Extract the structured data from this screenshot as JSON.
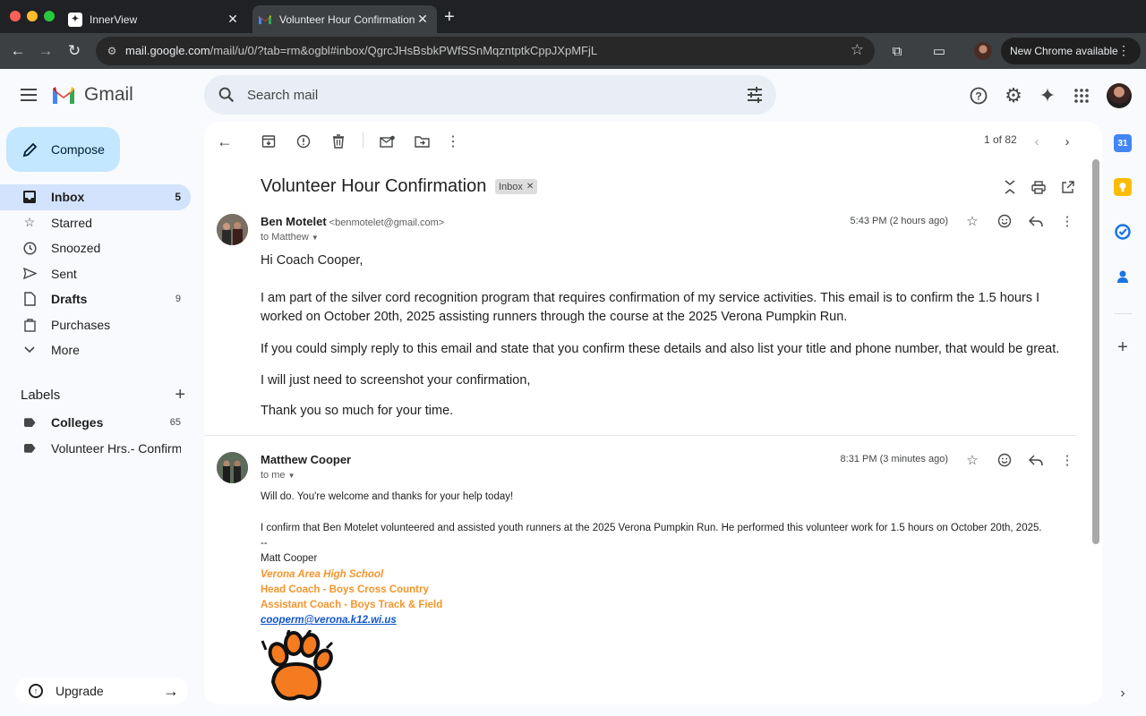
{
  "browser": {
    "tabs": [
      {
        "title": "InnerView",
        "active": false
      },
      {
        "title": "Volunteer Hour Confirmation",
        "active": true
      }
    ],
    "url_host": "mail.google.com",
    "url_path": "/mail/u/0/?tab=rm&ogbl#inbox/QgrcJHsBsbkPWfSSnMqzntptkCppJXpMFjL",
    "update_label": "New Chrome available"
  },
  "gmail": {
    "logo_text": "Gmail",
    "search_placeholder": "Search mail",
    "compose_label": "Compose",
    "nav": [
      {
        "label": "Inbox",
        "count": "5",
        "icon": "inbox-icon"
      },
      {
        "label": "Starred",
        "count": "",
        "icon": "star-icon"
      },
      {
        "label": "Snoozed",
        "count": "",
        "icon": "clock-icon"
      },
      {
        "label": "Sent",
        "count": "",
        "icon": "send-icon"
      },
      {
        "label": "Drafts",
        "count": "9",
        "icon": "draft-icon"
      },
      {
        "label": "Purchases",
        "count": "",
        "icon": "shopping-bag-icon"
      },
      {
        "label": "More",
        "count": "",
        "icon": "chevron-down-icon"
      }
    ],
    "labels_heading": "Labels",
    "labels": [
      {
        "label": "Colleges",
        "count": "65"
      },
      {
        "label": "Volunteer Hrs.- Confirm...",
        "count": ""
      }
    ],
    "upgrade_label": "Upgrade",
    "pager": "1 of 82"
  },
  "thread": {
    "subject": "Volunteer Hour Confirmation",
    "chip": "Inbox",
    "messages": [
      {
        "sender": "Ben Motelet",
        "email": "<benmotelet@gmail.com>",
        "to": "to Matthew",
        "time": "5:43 PM (2 hours ago)",
        "greeting": "Hi Coach Cooper,",
        "p1": "I am part of the silver cord recognition program that requires confirmation of my service activities. This email is to confirm the 1.5 hours I worked on October 20th, 2025 assisting runners through the course at the 2025 Verona Pumpkin Run.",
        "p2": "If you could simply reply to this email and state that you confirm these details and also list your title and phone number, that would be great.",
        "p3": "I will just need to screenshot your confirmation,",
        "p4": "Thank you so much for your time."
      },
      {
        "sender": "Matthew Cooper",
        "to": "to me",
        "time": "8:31 PM (3 minutes ago)",
        "l1": "Will do. You're welcome and thanks for your help today!",
        "l2": "I confirm that Ben Motelet volunteered and assisted youth runners at the 2025 Verona Pumpkin Run. He performed this volunteer work for 1.5 hours on October 20th, 2025.",
        "sig_dash": "--",
        "sig_name": "Matt Cooper",
        "sig_school": "Verona Area High School",
        "sig_title1": "Head Coach - Boys Cross Country",
        "sig_title2": "Assistant Coach - Boys Track & Field",
        "sig_email": "cooperm@verona.k12.wi.us"
      }
    ]
  },
  "colors": {
    "accent": "#0b57d0",
    "compose_bg": "#c2e7ff",
    "selected_nav": "#d3e3fd",
    "signature_orange": "#f4952b",
    "link_blue": "#1155cc"
  }
}
